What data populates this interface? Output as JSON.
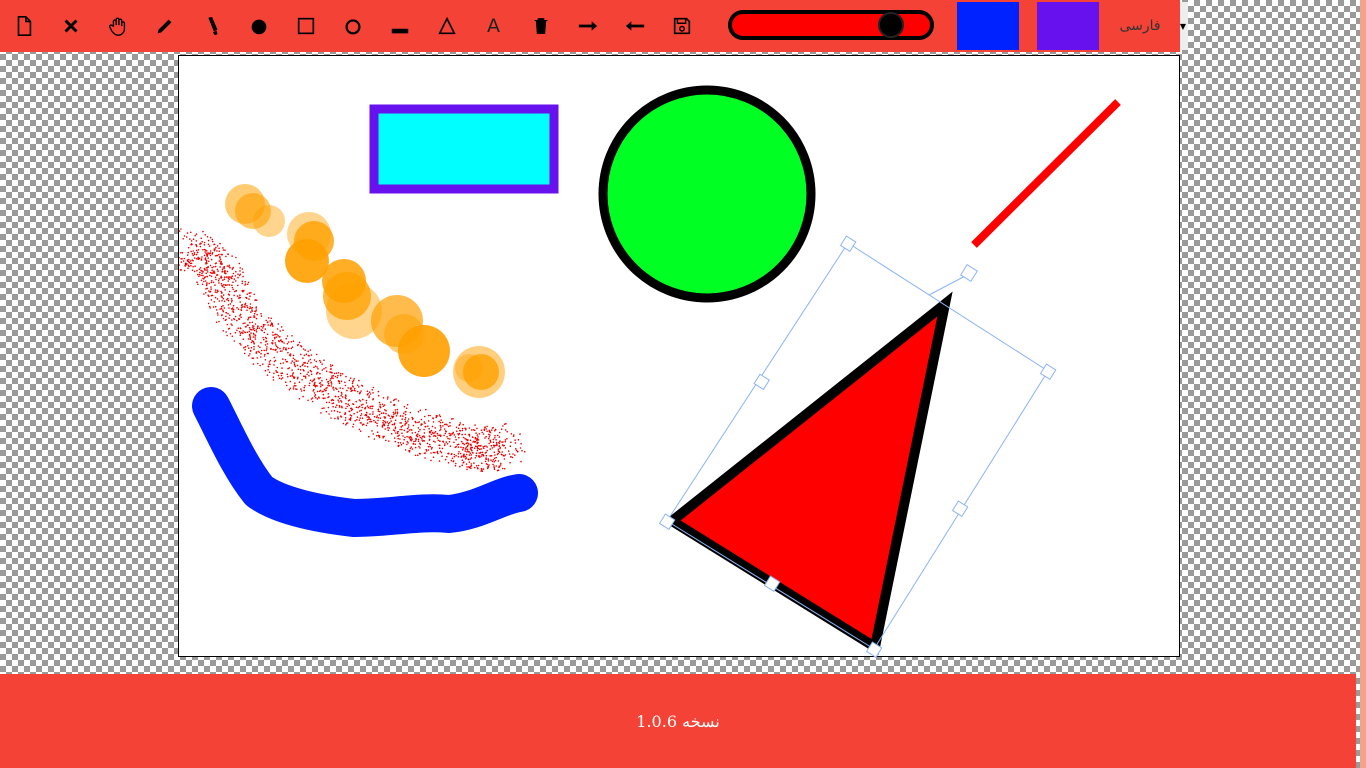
{
  "toolbar": {
    "tools": [
      {
        "name": "new-file-icon"
      },
      {
        "name": "clear-icon"
      },
      {
        "name": "pan-hand-icon"
      },
      {
        "name": "pencil-icon"
      },
      {
        "name": "marker-icon"
      },
      {
        "name": "filled-circle-icon"
      },
      {
        "name": "rectangle-icon"
      },
      {
        "name": "circle-icon"
      },
      {
        "name": "line-icon"
      },
      {
        "name": "triangle-icon"
      },
      {
        "name": "text-icon",
        "glyph": "A"
      },
      {
        "name": "trash-icon"
      },
      {
        "name": "redo-arrow-icon"
      },
      {
        "name": "undo-arrow-icon"
      },
      {
        "name": "save-icon"
      }
    ],
    "size_slider": {
      "value": 0.85,
      "track_color": "#ff0000",
      "thumb_color": "#000000"
    },
    "stroke_color": "#0022ff",
    "fill_color": "#6611ee",
    "language": "فارسی"
  },
  "canvas": {
    "background": "#ffffff"
  },
  "footer": {
    "version": "نسخه 1.0.6"
  }
}
